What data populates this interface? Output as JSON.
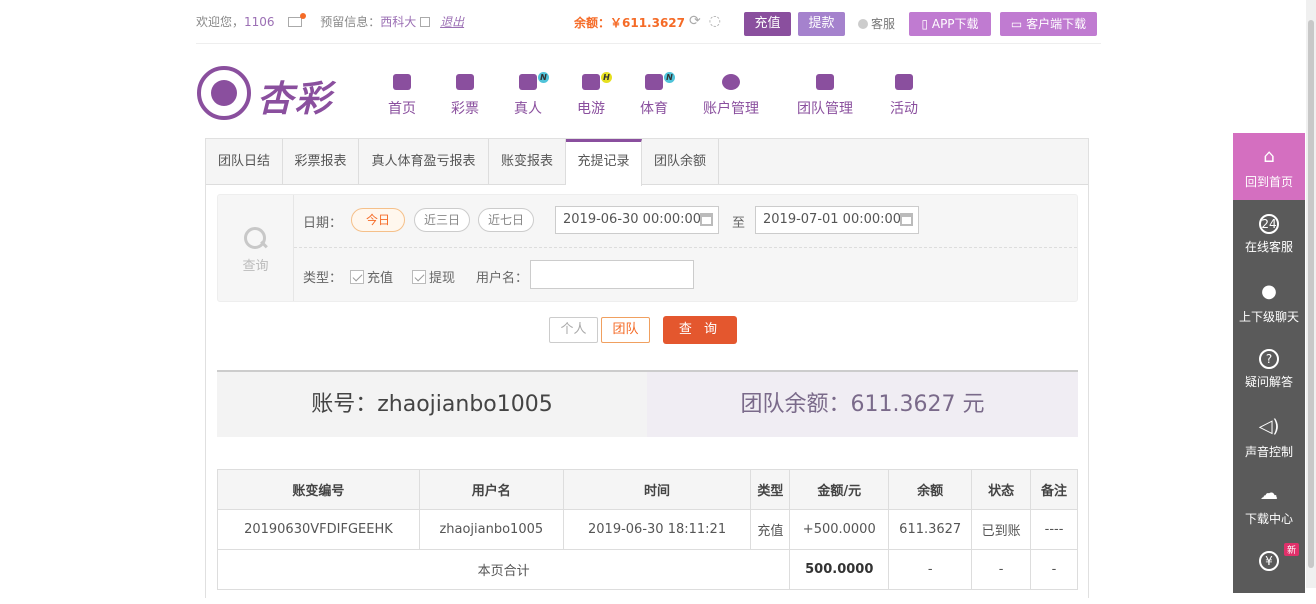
{
  "topbar": {
    "welcome": "欢迎您，",
    "user_number": "1106",
    "reserved_label": "预留信息：",
    "reserved_value": "西科大",
    "logout": "退出",
    "balance": "余额：￥611.3627",
    "recharge": "充值",
    "withdraw": "提款",
    "service": "客服",
    "app_download": "APP下载",
    "client_download": "客户端下载"
  },
  "logo": {
    "text": "杏彩"
  },
  "nav": [
    {
      "label": "首页",
      "icon": "home-icon",
      "badge": ""
    },
    {
      "label": "彩票",
      "icon": "lottery-icon",
      "badge": ""
    },
    {
      "label": "真人",
      "icon": "live-dealer-icon",
      "badge": "N"
    },
    {
      "label": "电游",
      "icon": "gamepad-icon",
      "badge": "H"
    },
    {
      "label": "体育",
      "icon": "trophy-icon",
      "badge": "N"
    },
    {
      "label": "账户管理",
      "icon": "yen-coin-icon",
      "badge": ""
    },
    {
      "label": "团队管理",
      "icon": "team-icon",
      "badge": ""
    },
    {
      "label": "活动",
      "icon": "gift-icon",
      "badge": ""
    }
  ],
  "tabs": [
    {
      "label": "团队日结",
      "active": false
    },
    {
      "label": "彩票报表",
      "active": false
    },
    {
      "label": "真人体育盈亏报表",
      "active": false
    },
    {
      "label": "账变报表",
      "active": false
    },
    {
      "label": "充提记录",
      "active": true
    },
    {
      "label": "团队余额",
      "active": false
    }
  ],
  "filter": {
    "query_label": "查询",
    "date_label": "日期：",
    "today": "今日",
    "three_days": "近三日",
    "seven_days": "近七日",
    "date_from": "2019-06-30 00:00:00",
    "to_label": "至",
    "date_to": "2019-07-01 00:00:00",
    "type_label": "类型：",
    "type_recharge": "充值",
    "type_withdraw": "提现",
    "username_label": "用户名：",
    "username_value": ""
  },
  "buttons": {
    "personal": "个人",
    "team": "团队",
    "query": "查 询"
  },
  "summary": {
    "account": "账号：zhaojianbo1005",
    "team_balance": "团队余额：611.3627 元"
  },
  "table": {
    "headers": [
      "账变编号",
      "用户名",
      "时间",
      "类型",
      "金额/元",
      "余额",
      "状态",
      "备注"
    ],
    "rows": [
      [
        "20190630VFDIFGEEHK",
        "zhaojianbo1005",
        "2019-06-30 18:11:21",
        "充值",
        "+500.0000",
        "611.3627",
        "已到账",
        "----"
      ]
    ],
    "total_label": "本页合计",
    "total_amount": "500.0000",
    "total_balance": "-",
    "total_status": "-",
    "total_note": "-"
  },
  "sidebar": [
    {
      "label": "回到首页",
      "icon": "home-icon"
    },
    {
      "label": "在线客服",
      "icon": "headset-24-icon"
    },
    {
      "label": "上下级聊天",
      "icon": "chat-bubble-icon"
    },
    {
      "label": "疑问解答",
      "icon": "question-icon"
    },
    {
      "label": "声音控制",
      "icon": "speaker-icon"
    },
    {
      "label": "下载中心",
      "icon": "cloud-download-icon"
    },
    {
      "label": "",
      "icon": "money-bag-icon"
    }
  ],
  "sidebar_new_badge": "新",
  "colors": {
    "brand_purple": "#8a4f9e",
    "accent_orange": "#f56b27",
    "query_button": "#e4572e",
    "sidebar_home": "#d46fc0",
    "sidebar_bg": "#5a5a5a"
  }
}
